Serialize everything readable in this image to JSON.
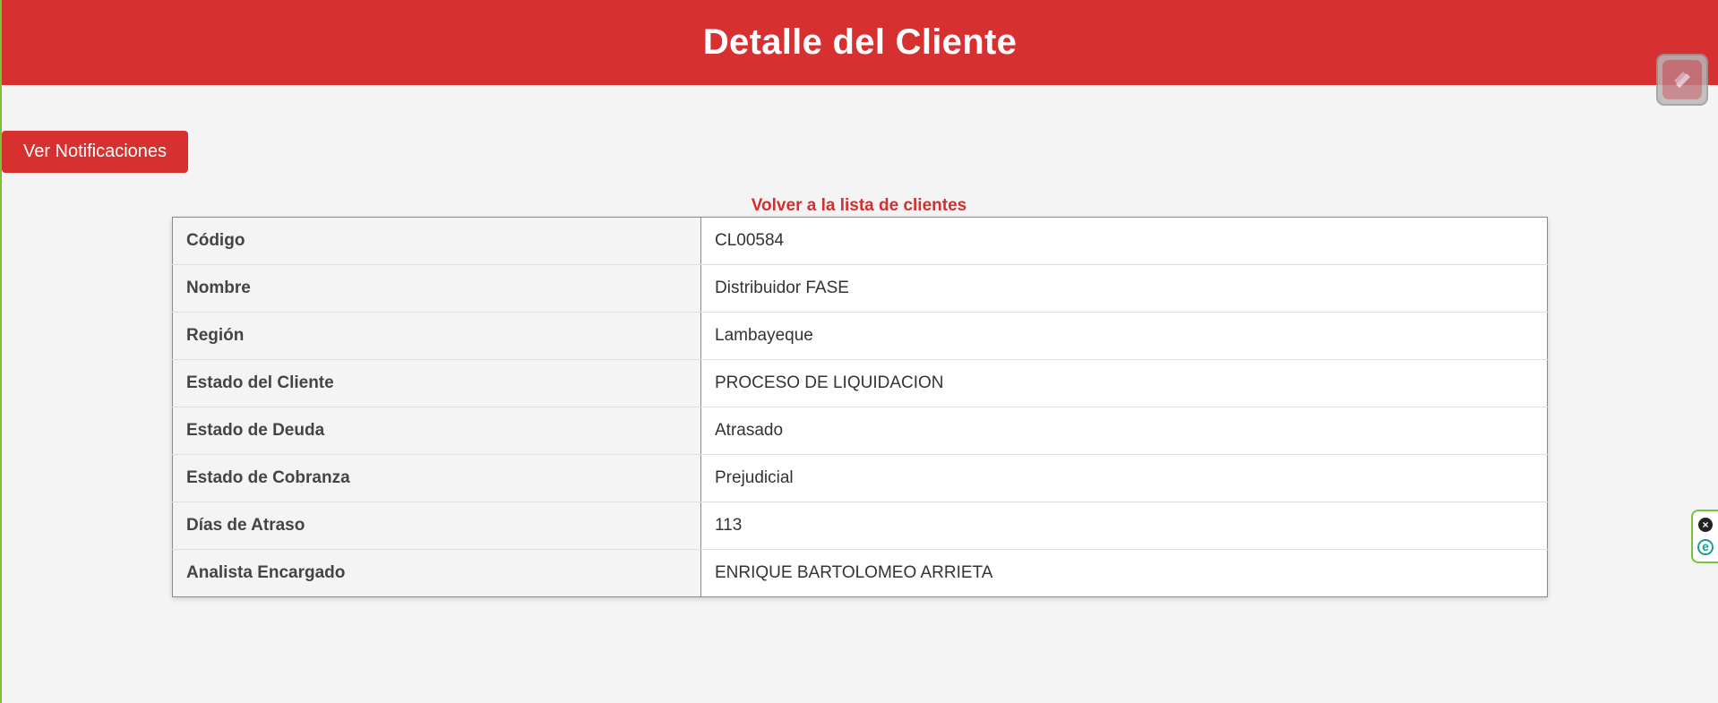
{
  "header": {
    "title": "Detalle del Cliente"
  },
  "actions": {
    "notifications_label": "Ver Notificaciones",
    "back_link_label": "Volver a la lista de clientes"
  },
  "client_details": {
    "rows": [
      {
        "label": "Código",
        "value": "CL00584"
      },
      {
        "label": "Nombre",
        "value": "Distribuidor FASE"
      },
      {
        "label": "Región",
        "value": "Lambayeque"
      },
      {
        "label": "Estado del Cliente",
        "value": "PROCESO DE LIQUIDACION"
      },
      {
        "label": "Estado de Deuda",
        "value": "Atrasado"
      },
      {
        "label": "Estado de Cobranza",
        "value": "Prejudicial"
      },
      {
        "label": "Días de Atraso",
        "value": "113"
      },
      {
        "label": "Analista Encargado",
        "value": "ENRIQUE BARTOLOMEO ARRIETA"
      }
    ]
  },
  "overlays": {
    "extension_icon": "pencil-extension-icon",
    "side_widget_icons": [
      "close-icon",
      "e-letter-icon"
    ]
  },
  "colors": {
    "primary_red": "#d63031",
    "link_red": "#d32f2f",
    "page_background": "#f4f4f4",
    "accent_green": "#7cc13a"
  }
}
